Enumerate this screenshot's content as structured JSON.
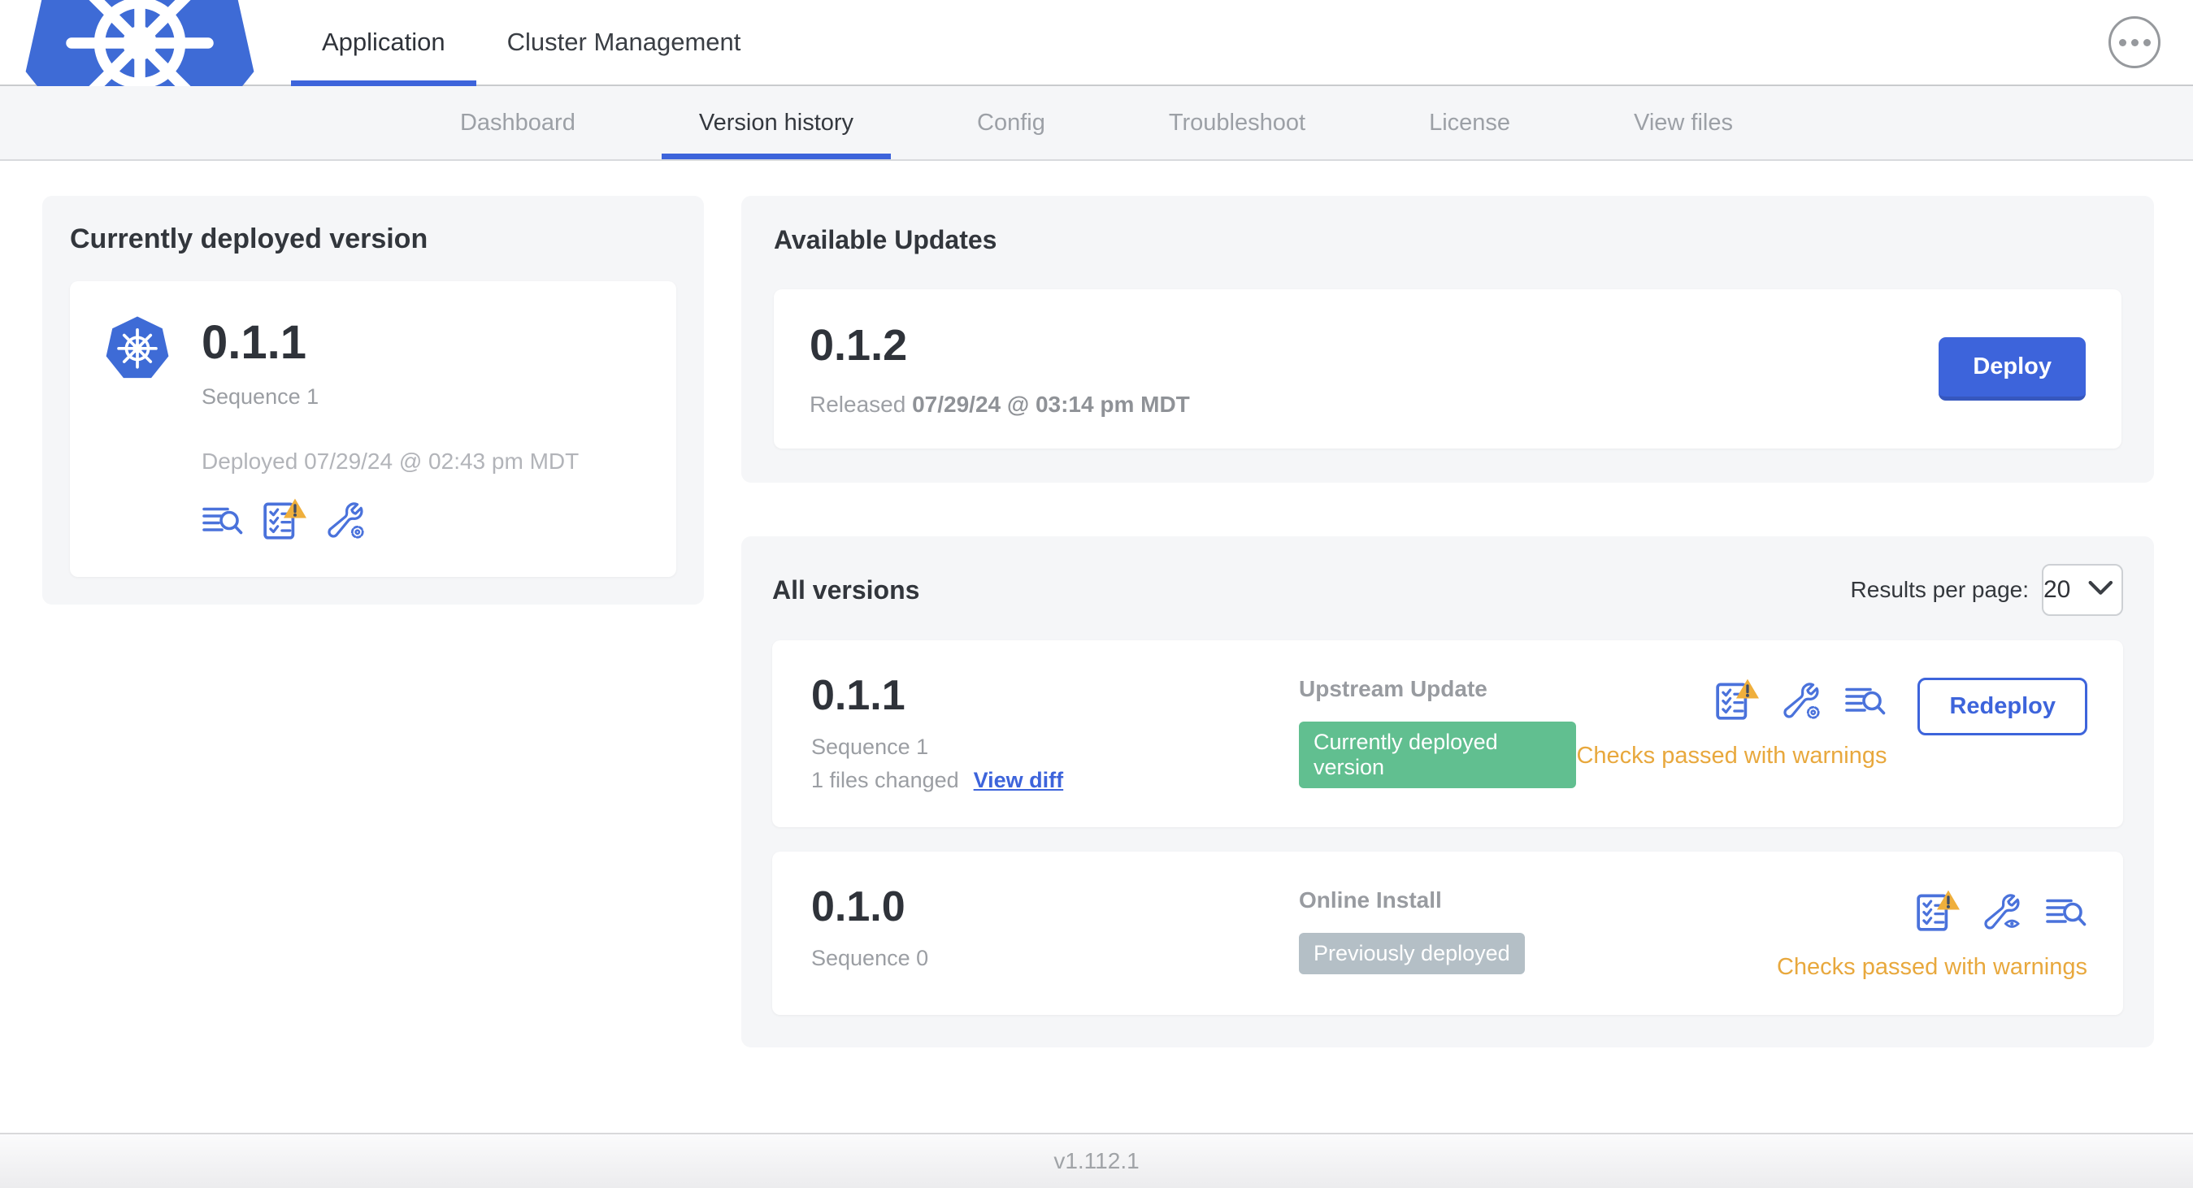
{
  "header": {
    "logo": "kubernetes-logo",
    "tabs": [
      {
        "label": "Application",
        "active": true
      },
      {
        "label": "Cluster Management",
        "active": false
      }
    ],
    "more_button": "ellipsis-icon"
  },
  "subnav": {
    "tabs": [
      {
        "label": "Dashboard",
        "active": false
      },
      {
        "label": "Version history",
        "active": true
      },
      {
        "label": "Config",
        "active": false
      },
      {
        "label": "Troubleshoot",
        "active": false
      },
      {
        "label": "License",
        "active": false
      },
      {
        "label": "View files",
        "active": false
      }
    ]
  },
  "current": {
    "title": "Currently deployed version",
    "version": "0.1.1",
    "sequence": "Sequence 1",
    "deployed": "Deployed 07/29/24 @ 02:43 pm MDT",
    "icons": [
      "logs-icon",
      "preflight-checks-warning-icon",
      "config-wrench-gear-icon"
    ]
  },
  "available": {
    "title": "Available Updates",
    "version": "0.1.2",
    "released_label": "Released",
    "released_date": "07/29/24 @ 03:14 pm MDT",
    "deploy_label": "Deploy"
  },
  "versions": {
    "title": "All versions",
    "per_page_label": "Results per page:",
    "per_page_value": "20",
    "rows": [
      {
        "version": "0.1.1",
        "sequence": "Sequence 1",
        "files_changed": "1 files changed",
        "view_diff_label": "View diff",
        "source": "Upstream Update",
        "badge": "Currently deployed version",
        "badge_style": "background-color:#61BF90",
        "icons": [
          "preflight-checks-warning-icon",
          "config-wrench-gear-icon",
          "logs-icon"
        ],
        "checks": "Checks passed with warnings",
        "action": "Redeploy"
      },
      {
        "version": "0.1.0",
        "sequence": "Sequence 0",
        "source": "Online Install",
        "badge": "Previously deployed",
        "badge_style": "background-color:#B4BFC6",
        "icons": [
          "preflight-checks-warning-icon",
          "config-wrench-eye-icon",
          "logs-icon"
        ],
        "checks": "Checks passed with warnings"
      }
    ]
  },
  "footer": {
    "version": "v1.112.1"
  },
  "colors": {
    "primary_blue": "#3D64DB",
    "icon_blue": "#4A72DB",
    "kubernetes_blue": "#3E6BD6",
    "warning_amber": "#E8A83D",
    "badge_green": "#61BF90",
    "badge_gray": "#B4BFC6",
    "card_bg": "#F5F6F8"
  }
}
